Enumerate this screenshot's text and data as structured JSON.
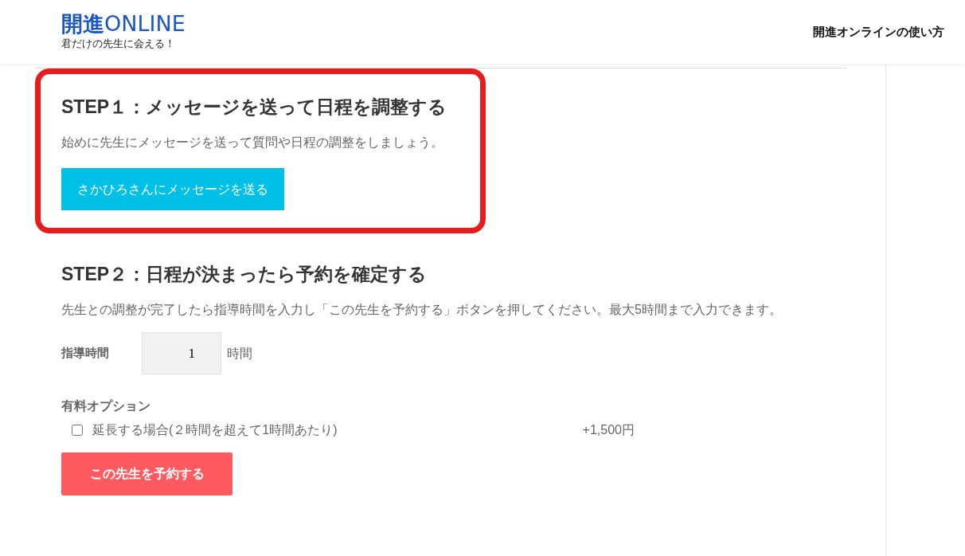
{
  "header": {
    "logo": {
      "brand": "開進",
      "suffix": "ONLINE"
    },
    "tagline": "君だけの先生に会える！",
    "nav": [
      "開進オンラインの使い方"
    ]
  },
  "steps": [
    {
      "title": "STEP１：メッセージを送って日程を調整する",
      "text": "始めに先生にメッセージを送って質問や日程の調整をしましょう。",
      "button": "さかひろさんにメッセージを送る",
      "highlighted": true
    },
    {
      "title": "STEP２：日程が決まったら予約を確定する",
      "text": "先生との調整が完了したら指導時間を入力し「この先生を予約する」ボタンを押してください。最大5時間まで入力できます。",
      "highlighted": false
    }
  ],
  "hours": {
    "label": "指導時間",
    "value": "1",
    "unit": "時間"
  },
  "options": {
    "title": "有料オプション",
    "items": [
      {
        "label": "延長する場合(２時間を超えて1時間あたり)",
        "price": "+1,500円",
        "checked": false
      }
    ]
  },
  "submit": "この先生を予約する"
}
